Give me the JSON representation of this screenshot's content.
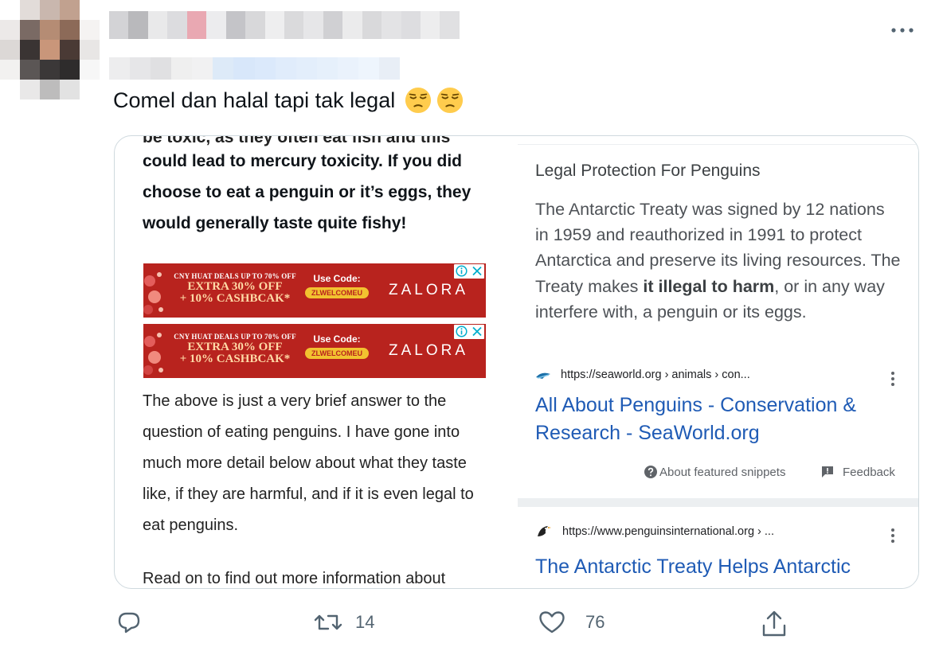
{
  "tweet": {
    "text": "Comel dan halal tapi tak legal",
    "emojis": [
      "pensive-face",
      "pensive-face"
    ]
  },
  "media": {
    "left_article": {
      "partial_top_line": "be toxic, as they often eat fish and this",
      "bold_paragraph": "could lead to mercury toxicity. If you did choose to eat a penguin or it’s eggs, they would generally taste quite fishy!",
      "ads": [
        {
          "deal_line1": "CNY HUAT DEALS UP TO 70% OFF",
          "deal_line2": "EXTRA 30% OFF",
          "deal_line3": "+ 10% CASHBCAK*",
          "code_label": "Use Code:",
          "code": "ZLWELCOMEU",
          "brand": "ZALORA"
        },
        {
          "deal_line1": "CNY HUAT DEALS UP TO 70% OFF",
          "deal_line2": "EXTRA 30% OFF",
          "deal_line3": "+ 10% CASHBCAK*",
          "code_label": "Use Code:",
          "code": "ZLWELCOMEU",
          "brand": "ZALORA"
        }
      ],
      "body_paragraph": "The above is just a very brief answer to the question of eating penguins. I have gone into much more detail below about what they taste like, if they are harmful, and if it is even legal to eat penguins.",
      "cut_line": "Read on to find out more information about"
    },
    "right_search": {
      "snippet_title": "Legal Protection For Penguins",
      "snippet_text_before": "The Antarctic Treaty was signed by 12 nations in 1959 and reauthorized in 1991 to protect Antarctica and preserve its living resources. The Treaty makes ",
      "snippet_text_bold": "it illegal to harm",
      "snippet_text_after": ", or in any way interfere with, a penguin or its eggs.",
      "source_url": "https://seaworld.org › animals › con...",
      "result_title": "All About Penguins - Conservation & Research - SeaWorld.org",
      "about_snippets": "About featured snippets",
      "feedback": "Feedback",
      "source_url_2": "https://www.penguinsinternational.org › ...",
      "result_title_2": "The Antarctic Treaty Helps Antarctic"
    }
  },
  "actions": {
    "reply_count": "",
    "retweet_count": "14",
    "like_count": "76"
  },
  "colors": {
    "link_blue": "#1f5bb5",
    "ad_red": "#b8231e",
    "icon_gray": "#536471"
  }
}
